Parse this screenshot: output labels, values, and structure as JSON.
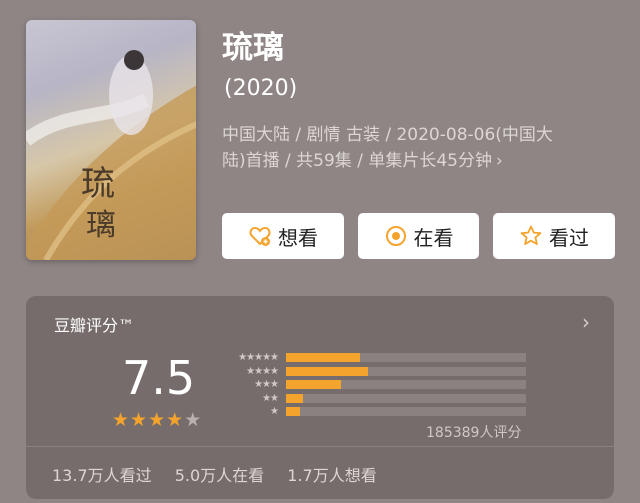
{
  "poster": {
    "icon": "drama-poster-image"
  },
  "drama": {
    "title": "琉璃",
    "year": "(2020)",
    "meta_line1": "中国大陆 / 剧情 古装 / 2020-08-06(中国大",
    "meta_line2": "陆)首播 / 共59集 / 单集片长45分钟",
    "chevron": "›"
  },
  "actions": {
    "want": {
      "label": "想看",
      "icon": "heart-plus-icon",
      "color": "#f4a32c"
    },
    "watching": {
      "label": "在看",
      "icon": "target-icon",
      "color": "#f4a32c"
    },
    "watched": {
      "label": "看过",
      "icon": "star-outline-icon",
      "color": "#f4a32c"
    }
  },
  "rating": {
    "card_title": "豆瓣评分™",
    "chevron": "›",
    "score": "7.5",
    "score_stars": 3.75,
    "distribution": [
      {
        "stars_label": "★★★★★",
        "fraction": 0.31
      },
      {
        "stars_label": "★★★★",
        "fraction": 0.34
      },
      {
        "stars_label": "★★★",
        "fraction": 0.23
      },
      {
        "stars_label": "★★",
        "fraction": 0.07
      },
      {
        "stars_label": "★",
        "fraction": 0.06
      }
    ],
    "count_text": "185389人评分",
    "stats": {
      "watched": "13.7万人看过",
      "watching": "5.0万人在看",
      "want": "1.7万人想看"
    }
  }
}
